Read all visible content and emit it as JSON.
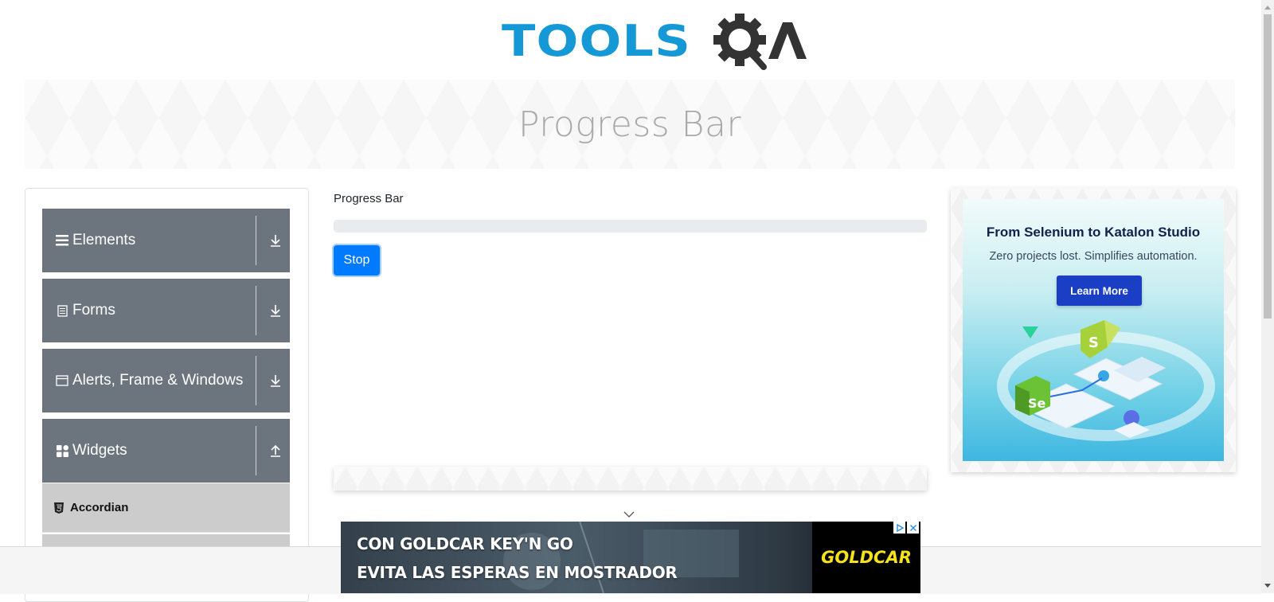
{
  "logo": {
    "text_part": "TOOLS",
    "mark_part": "QA"
  },
  "banner": {
    "title": "Progress Bar"
  },
  "sidebar": {
    "groups": [
      {
        "label": "Elements",
        "icon": "menu-lines-icon",
        "state": "collapsed"
      },
      {
        "label": "Forms",
        "icon": "document-icon",
        "state": "collapsed"
      },
      {
        "label": "Alerts, Frame & Windows",
        "icon": "window-icon",
        "state": "collapsed"
      },
      {
        "label": "Widgets",
        "icon": "widgets-grid-icon",
        "state": "expanded"
      }
    ],
    "subitems": [
      {
        "label": "Accordian",
        "icon": "html5-icon"
      }
    ]
  },
  "main": {
    "label": "Progress Bar",
    "progress_percent": 0,
    "stop_label": "Stop"
  },
  "right_ad": {
    "headline": "From Selenium to Katalon Studio",
    "subline": "Zero projects lost. Simplifies automation.",
    "cta": "Learn More",
    "badge_selenium": "Se",
    "badge_katalon": "S"
  },
  "bottom_ad": {
    "line1": "CON GOLDCAR KEY'N GO",
    "line2": "EVITA LAS ESPERAS EN MOSTRADOR",
    "brand": "GOLDCAR"
  },
  "colors": {
    "brand_blue": "#1599d6",
    "sidebar_header": "#6c757d",
    "primary_button": "#007bff",
    "ad_cta": "#1a3fc4",
    "goldcar_yellow": "#f3e21c"
  }
}
